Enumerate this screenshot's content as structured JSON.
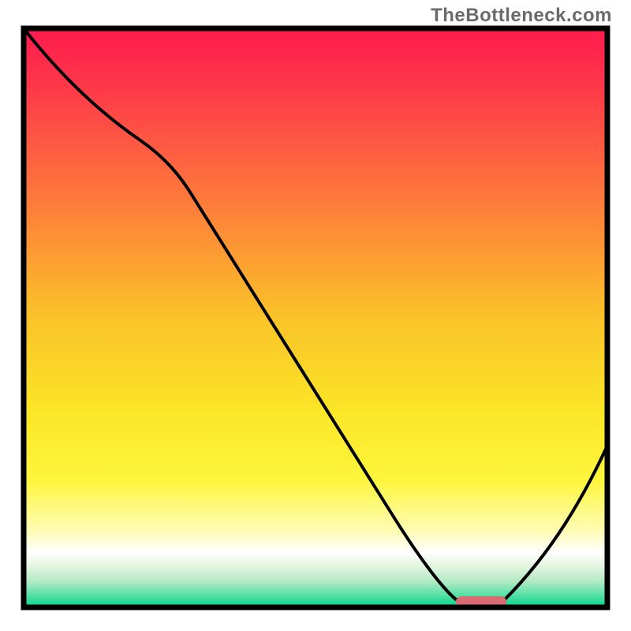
{
  "watermark": "TheBottleneck.com",
  "chart_data": {
    "type": "line",
    "title": "",
    "xlabel": "",
    "ylabel": "",
    "xlim": [
      0,
      100
    ],
    "ylim": [
      0,
      100
    ],
    "x": [
      0,
      12,
      20,
      28,
      63,
      78,
      82,
      100
    ],
    "values": [
      100,
      88,
      80,
      74,
      16,
      0.5,
      0.5,
      28
    ],
    "indicator_bar": {
      "x_start": 74,
      "x_end": 83,
      "y": 0.5,
      "color": "#d96b73"
    },
    "colors": {
      "bg_top": "#fe1b4e",
      "bg_upper_mid": "#fe7b3b",
      "bg_mid": "#fac328",
      "bg_lower_mid": "#fdf63c",
      "bg_cream": "#fffbd9",
      "bg_white": "#ffffff",
      "bg_green_light": "#b3eac3",
      "bg_green": "#00d58a",
      "curve": "#000000",
      "border": "#000000"
    }
  }
}
